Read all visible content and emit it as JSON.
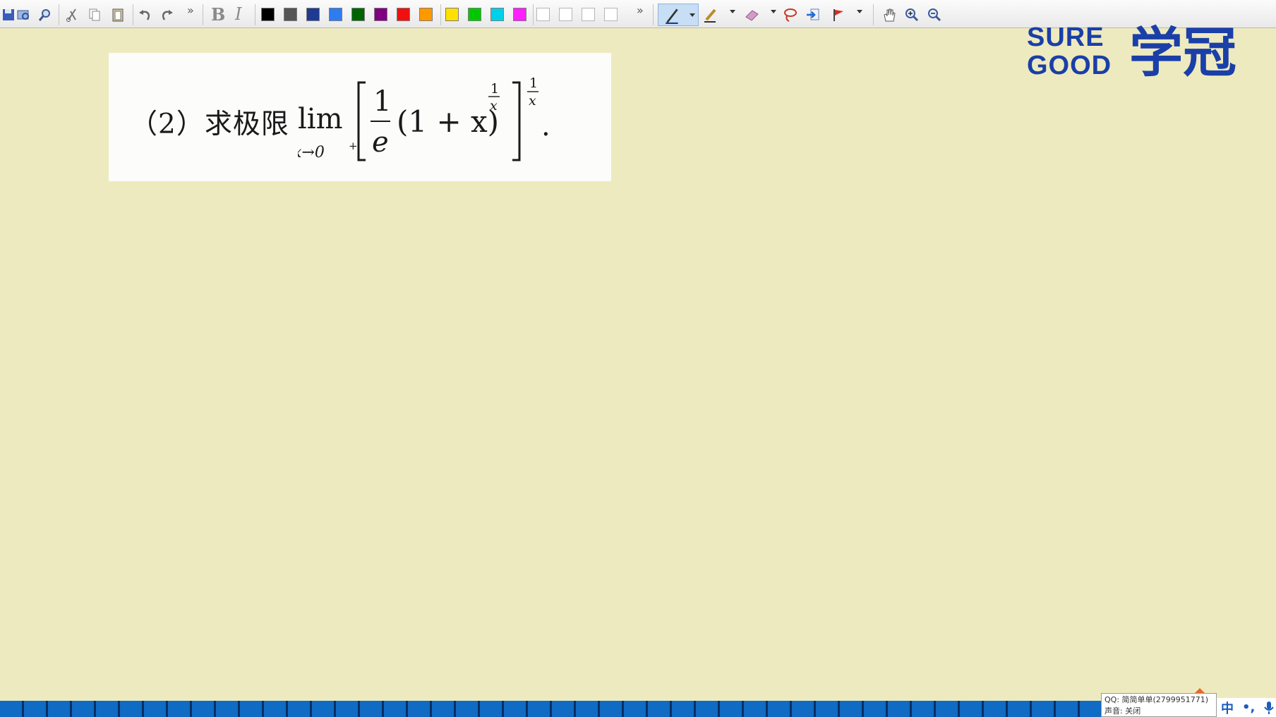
{
  "toolbar": {
    "overflow_glyph": "»",
    "format_bold_label": "B",
    "format_italic_label": "I",
    "icons_left": [
      "save-icon",
      "open-icon",
      "find-icon",
      "cut-icon",
      "copy-icon",
      "paste-icon",
      "undo-icon",
      "redo-icon"
    ],
    "colors": [
      "#000000",
      "#555555",
      "#1f3a93",
      "#2f7bf0",
      "#006400",
      "#800080",
      "#f01010",
      "#ff9900",
      "#ffe000",
      "#00c800",
      "#00d0e8",
      "#ff20ff"
    ],
    "empty_swatches": 4,
    "tools": [
      "pen-icon",
      "highlighter-icon",
      "eraser-icon",
      "lasso-icon",
      "insert-icon",
      "flag-icon",
      "hand-icon",
      "zoom-in-icon",
      "zoom-out-icon"
    ]
  },
  "question": {
    "label": "（2）求极限",
    "formula": {
      "lim": "lim",
      "subscript": "x→0",
      "subscript_sup": "+",
      "frac_num": "1",
      "frac_den": "e",
      "paren_expr": "(1 + x)",
      "inner_exp_num": "1",
      "inner_exp_den": "x",
      "outer_exp_num": "1",
      "outer_exp_den": "x",
      "period": "."
    }
  },
  "logo": {
    "line1": "SURE",
    "line2": "GOOD",
    "chinese": "学冠",
    "color": "#1a3fa8"
  },
  "status": {
    "qq_line": "QQ: 简简单单(2799951771)",
    "sound_line": "声音: 关闭",
    "ime_lang": "中",
    "ime_punct": "•,"
  }
}
